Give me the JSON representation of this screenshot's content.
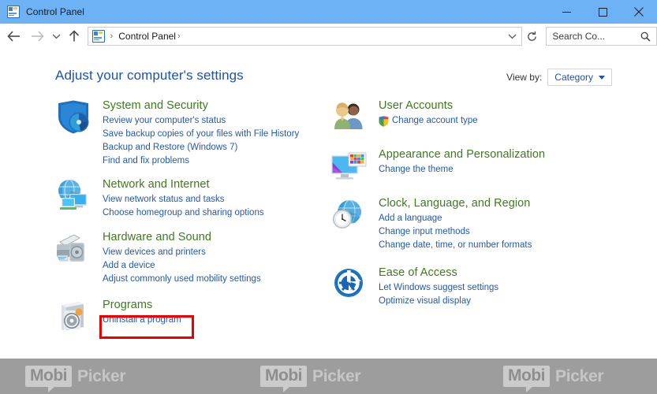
{
  "window": {
    "title": "Control Panel",
    "icon": "control-panel-icon",
    "buttons": {
      "minimize": "minimize-icon",
      "maximize": "maximize-icon",
      "close": "close-icon"
    }
  },
  "navbar": {
    "back": "back-arrow-icon",
    "forward": "forward-arrow-icon",
    "recent": "chevron-down-icon",
    "up": "up-arrow-icon",
    "breadcrumb": {
      "icon": "control-panel-icon",
      "items": [
        "Control Panel"
      ],
      "separator": "›"
    },
    "address_dropdown": "chevron-down-icon",
    "refresh": "refresh-icon",
    "search": {
      "placeholder": "Search Co...",
      "icon": "search-icon"
    }
  },
  "page": {
    "heading": "Adjust your computer's settings",
    "view_by": {
      "label": "View by:",
      "value": "Category",
      "caret": "caret-down-icon"
    }
  },
  "colors": {
    "titlebar": "#6cb2f5",
    "heading": "#1f53a5",
    "category_title": "#3f7a1e",
    "link": "#2359ac",
    "highlight": "#ee0000",
    "watermark_bar": "#9d9d9d"
  },
  "categories": {
    "left": [
      {
        "title": "System and Security",
        "icon": "shield-icon",
        "links": [
          {
            "text": "Review your computer's status"
          },
          {
            "text": "Save backup copies of your files with File History"
          },
          {
            "text": "Backup and Restore (Windows 7)"
          },
          {
            "text": "Find and fix problems"
          }
        ]
      },
      {
        "title": "Network and Internet",
        "icon": "network-globe-icon",
        "links": [
          {
            "text": "View network status and tasks"
          },
          {
            "text": "Choose homegroup and sharing options"
          }
        ]
      },
      {
        "title": "Hardware and Sound",
        "icon": "printer-icon",
        "links": [
          {
            "text": "View devices and printers"
          },
          {
            "text": "Add a device"
          },
          {
            "text": "Adjust commonly used mobility settings"
          }
        ]
      },
      {
        "title": "Programs",
        "icon": "programs-disc-icon",
        "links": [
          {
            "text": "Uninstall a program",
            "highlighted": true
          }
        ]
      }
    ],
    "right": [
      {
        "title": "User Accounts",
        "icon": "user-accounts-icon",
        "links": [
          {
            "text": "Change account type",
            "shield": true
          }
        ]
      },
      {
        "title": "Appearance and Personalization",
        "icon": "appearance-monitor-icon",
        "links": [
          {
            "text": "Change the theme"
          }
        ]
      },
      {
        "title": "Clock, Language, and Region",
        "icon": "clock-globe-icon",
        "links": [
          {
            "text": "Add a language"
          },
          {
            "text": "Change input methods"
          },
          {
            "text": "Change date, time, or number formats"
          }
        ]
      },
      {
        "title": "Ease of Access",
        "icon": "ease-of-access-icon",
        "links": [
          {
            "text": "Let Windows suggest settings"
          },
          {
            "text": "Optimize visual display"
          }
        ]
      }
    ]
  },
  "watermarks": [
    {
      "first": "Mobi",
      "second": "Picker"
    },
    {
      "first": "Mobi",
      "second": "Picker"
    },
    {
      "first": "Mobi",
      "second": "Picker"
    }
  ]
}
